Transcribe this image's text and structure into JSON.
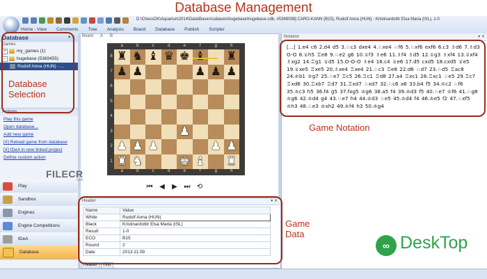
{
  "annotations": {
    "title": "Database Management",
    "database_selection": "Database Selection",
    "game_notation": "Game Notation",
    "game_data": "Game Data"
  },
  "window": {
    "path": "D:\\ChessOK\\Aquarium2014\\Data\\Bases\\cabases\\hugebase\\hugebase.cdb, #5369098] CARO-KANN (B15), Rudolf Anna (HUN) - Kristinardottir Elsa Maria (ISL), 1-0",
    "menu": [
      "Home - View",
      "Comments",
      "Tree",
      "Analysis",
      "Board",
      "Database",
      "Publish",
      "Scripter"
    ]
  },
  "sheets": [
    "Board",
    "A",
    "B"
  ],
  "left_panel": {
    "title": "Database",
    "pin": "▾ ✕",
    "games_label": "Games",
    "tree": [
      {
        "label": "my_games (1)",
        "expander": "+"
      },
      {
        "label": "hugebase (5369455)",
        "expander": "-"
      },
      {
        "label": "Rudolf Anna (HUN) - ...",
        "selected": true
      }
    ],
    "actions_label": "Actions",
    "actions": [
      "Play this game",
      "Open database...",
      "Add new game",
      "[X] Reload game from database",
      "[X] IDeA in new linked project",
      "Define custom action"
    ],
    "modules": [
      {
        "label": "Play",
        "icon": "play-icon",
        "color": "#d94c3d"
      },
      {
        "label": "Sandbox",
        "icon": "sandbox-icon",
        "color": "#c7a14a"
      },
      {
        "label": "Engines",
        "icon": "engines-icon",
        "color": "#8b97a8"
      },
      {
        "label": "Engine Competitions",
        "icon": "competitions-icon",
        "color": "#5b8bd0"
      },
      {
        "label": "IDeA",
        "icon": "idea-icon",
        "color": "#9d9d9d"
      },
      {
        "label": "Database",
        "icon": "database-icon",
        "color": "#f2c14e",
        "active": true
      }
    ]
  },
  "board": {
    "files": [
      "a",
      "b",
      "c",
      "d",
      "e",
      "f",
      "g",
      "h"
    ],
    "ranks": [
      "8",
      "7",
      "6",
      "5",
      "4",
      "3",
      "2",
      "1"
    ],
    "position": [
      [
        "bR",
        "bN",
        "bB",
        "bQ",
        "bK",
        "bB",
        "",
        "bR"
      ],
      [
        "bP",
        "bP",
        "",
        "",
        "",
        "bP",
        "bP",
        "bP"
      ],
      [
        "",
        "",
        "",
        "",
        "",
        "",
        "",
        ""
      ],
      [
        "",
        "",
        "",
        "",
        "",
        "",
        "",
        ""
      ],
      [
        "",
        "",
        "",
        "",
        "",
        "",
        "",
        ""
      ],
      [
        "",
        "",
        "",
        "",
        "wP",
        "",
        "",
        ""
      ],
      [
        "wP",
        "wP",
        "wP",
        "",
        "",
        "",
        "wP",
        "wP"
      ],
      [
        "wR",
        "wN",
        "",
        "",
        "wK",
        "wB",
        "",
        "wR"
      ]
    ],
    "nav": [
      "⏮",
      "◀",
      "▶",
      "⏭",
      "⟲"
    ]
  },
  "notation": {
    "title": "Notation",
    "controls": "▾ ✕",
    "text": "[...] 1.e4 c6 2.d4 d5 3.♘c3 dxe4 4.♘xe4 ♘f6 5.♘xf6 exf6 6.c3 ♗d6 7.♗d3 O-O 8.♕h5 ♖e8 9.♘e2 g6 10.♕f3 ♗e6 11.♗f4 ♗d5 12.♕g3 ♗xf4 13.♕xf4 ♗xg2 14.♖g1 ♕d5 15.O-O-O ♗e4 16.c4 ♕e6 17.d5 cxd5 18.cxd5 ♕e5 19.♕xe5 ♖xe5 20.♗xe4 ♖xe4 21.♘c3 ♖e8 22.d6 ♘d7 23.♘d5 ♖ac8 24.♔b1 ♔g7 25.♘e7 ♖c5 26.♖c1 ♖d8 27.a4 ♖xc1 28.♖xc1 ♘e5 29.♖c7 ♖xd6 30.♖xb7 ♖d7 31.♖xd7 ♘xd7 32.♘c6 a6 33.b4 f5 34.♔c2 ♘f6 35.♔c3 h5 36.f4 g5 37.fxg5 ♔g6 38.a5 f4 39.♔d3 f5 40.♘e7 ♔f6 41.♘g8 ♔g6 42.♔d4 g4 43.♘e7 h4 44.♔d3 ♘e5 45.♔d4 f4 46.♔e5 f2 47.♘xf5 ♔h3 48.♘e3 ♔xh2 49.♔f4 h3 50.♔g4"
  },
  "header": {
    "title": "Header",
    "controls": "▾ ✕",
    "columns": [
      "Name",
      "Value"
    ],
    "rows": [
      {
        "name": "White",
        "value": "Rudolf Anna (HUN)"
      },
      {
        "name": "Black",
        "value": "Kristinardottir Elsa Maria (ISL)"
      },
      {
        "name": "Result",
        "value": "1-0"
      },
      {
        "name": "ECO",
        "value": "B15"
      },
      {
        "name": "Round",
        "value": "2"
      },
      {
        "name": "Date",
        "value": "2013.11.09"
      }
    ],
    "tabs": [
      "Header",
      "Hist"
    ]
  },
  "watermarks": {
    "filecr": "FILECR",
    "filecr_sub": ".com",
    "desktop_logo": "∞",
    "desktop_text": "DeskTop"
  },
  "colors": {
    "annotation": "#b5331c",
    "selected": "#2d4f8c",
    "active_module": "#f3b54a"
  }
}
